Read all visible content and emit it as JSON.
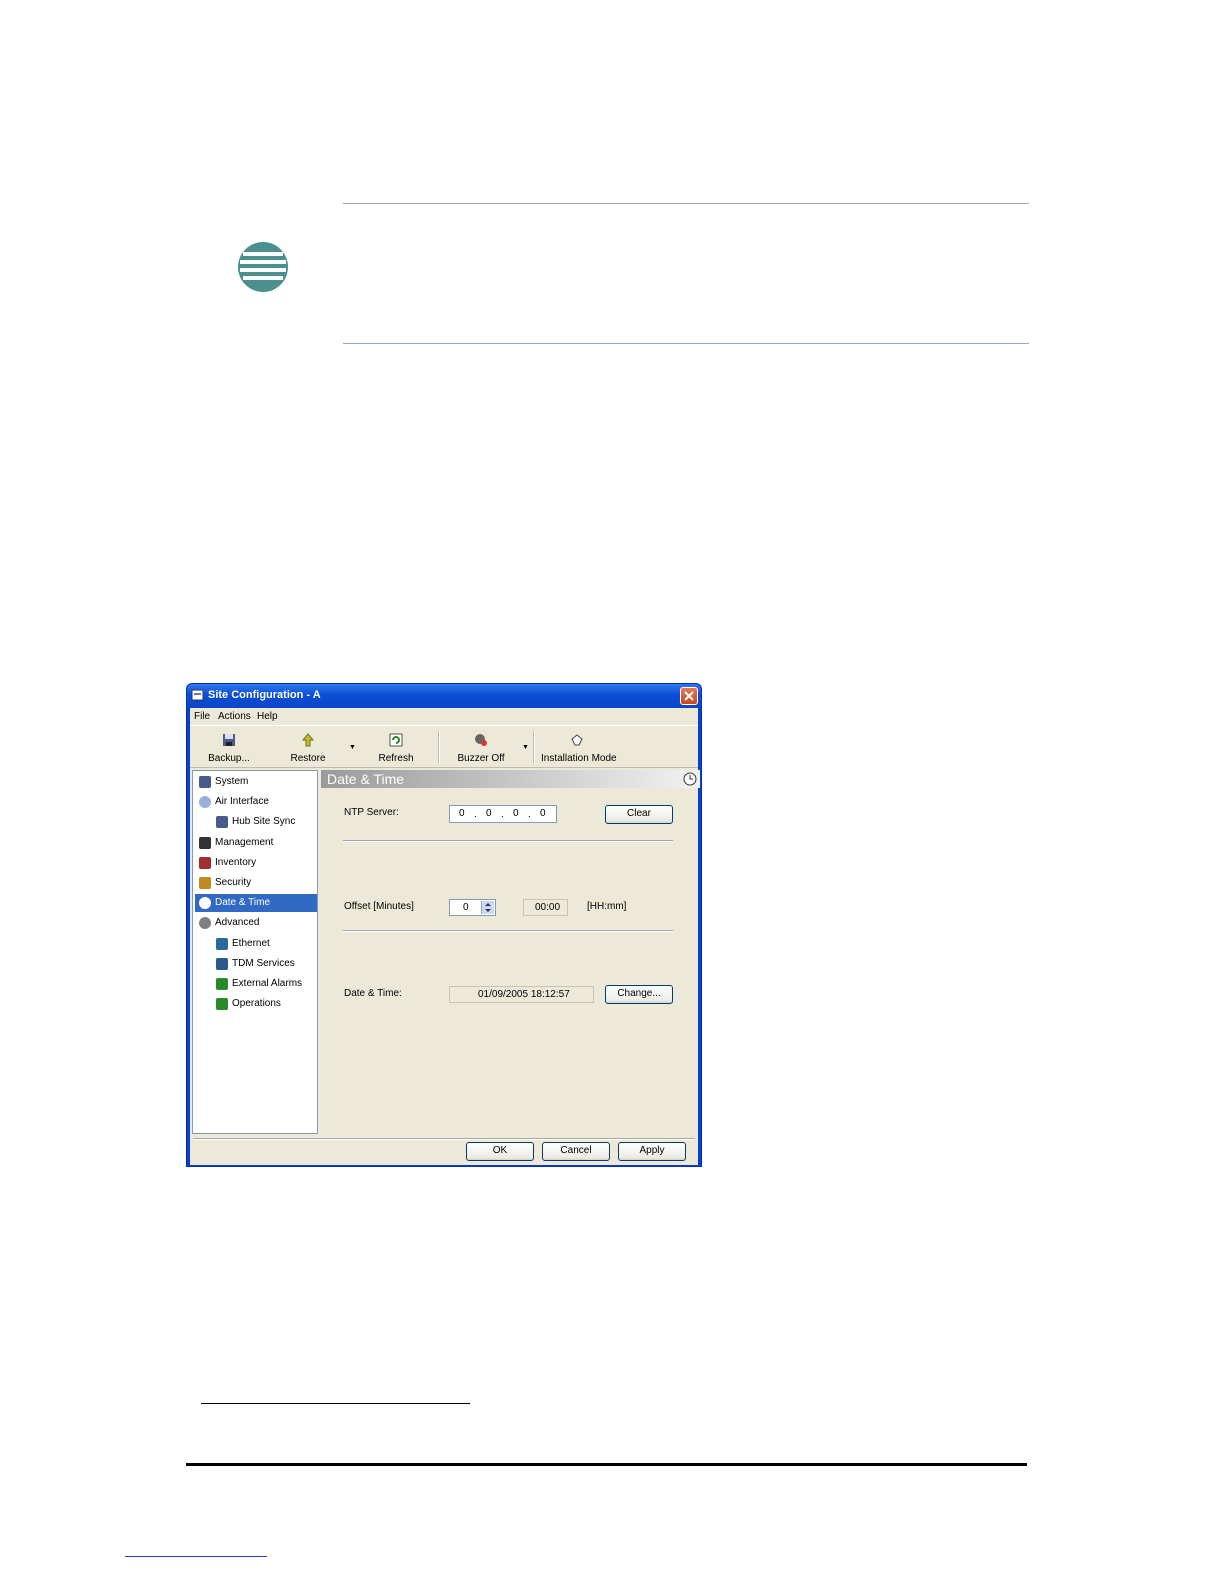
{
  "dialog": {
    "title": "Site Configuration - A",
    "menu": [
      "File",
      "Actions",
      "Help"
    ],
    "toolbar": {
      "backup": "Backup...",
      "restore": "Restore",
      "refresh": "Refresh",
      "buzzer_off": "Buzzer Off",
      "installation_mode": "Installation Mode"
    },
    "tree": [
      {
        "label": "System",
        "icon": "system-icon"
      },
      {
        "label": "Air Interface",
        "icon": "air-interface-icon"
      },
      {
        "label": "Hub Site Sync",
        "icon": "hub-sync-icon"
      },
      {
        "label": "Management",
        "icon": "management-icon"
      },
      {
        "label": "Inventory",
        "icon": "inventory-icon"
      },
      {
        "label": "Security",
        "icon": "security-icon"
      },
      {
        "label": "Date & Time",
        "icon": "clock-icon",
        "selected": true
      },
      {
        "label": "Advanced",
        "icon": "advanced-icon"
      },
      {
        "label": "Ethernet",
        "icon": "ethernet-icon"
      },
      {
        "label": "TDM Services",
        "icon": "tdm-icon"
      },
      {
        "label": "External Alarms",
        "icon": "alarm-icon"
      },
      {
        "label": "Operations",
        "icon": "operations-icon"
      }
    ],
    "panel": {
      "title": "Date & Time",
      "ntp_label": "NTP Server:",
      "ntp_octets": [
        "0",
        "0",
        "0",
        "0"
      ],
      "ntp_dot": ".",
      "clear": "Clear",
      "offset_label": "Offset [Minutes]",
      "offset_value": "0",
      "offset_hhmm": "00:00",
      "offset_unit": "[HH:mm]",
      "datetime_label": "Date & Time:",
      "datetime_value": "01/09/2005 18:12:57",
      "change": "Change..."
    },
    "buttons": {
      "ok": "OK",
      "cancel": "Cancel",
      "apply": "Apply"
    },
    "colors": {
      "selection": "#316ac5",
      "titlebar": "#0b4fd6",
      "client": "#ece9d8"
    }
  }
}
